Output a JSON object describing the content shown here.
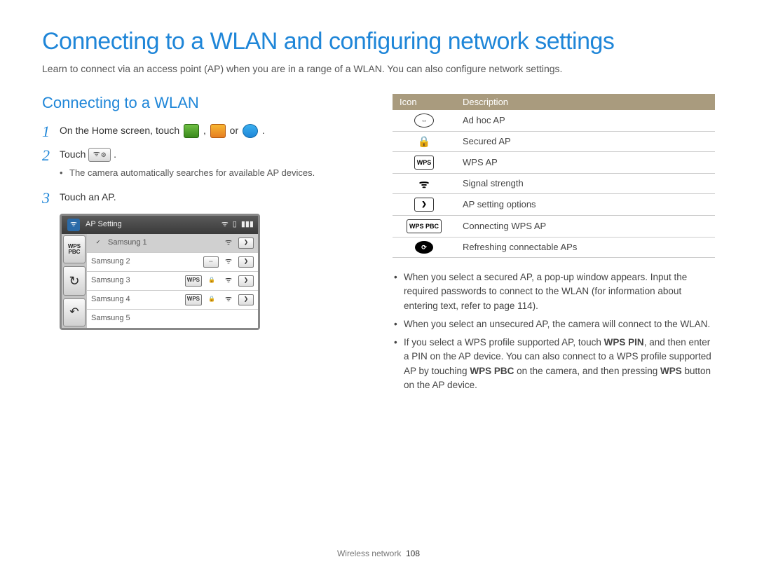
{
  "title": "Connecting to a WLAN and configuring network settings",
  "intro": "Learn to connect via an access point (AP) when you are in a range of a WLAN. You can also configure network settings.",
  "section": "Connecting to a WLAN",
  "steps": {
    "s1a": "On the Home screen, touch ",
    "s1b": ", ",
    "s1c": " or ",
    "s1d": ".",
    "s2a": "Touch ",
    "s2b": ".",
    "s2_sub": "The camera automatically searches for available AP devices.",
    "s3": "Touch an AP."
  },
  "device": {
    "header": "AP Setting",
    "side": {
      "wps": "WPS\nPBC",
      "refresh": "↻",
      "back": "↶"
    },
    "rows": [
      {
        "name": "Samsung 1",
        "selected": true,
        "badges": [
          "check",
          "wifi",
          "arrow"
        ]
      },
      {
        "name": "Samsung 2",
        "selected": false,
        "badges": [
          "adhoc",
          "wifi",
          "arrow"
        ]
      },
      {
        "name": "Samsung 3",
        "selected": false,
        "badges": [
          "wps",
          "lock",
          "wifi",
          "arrow"
        ]
      },
      {
        "name": "Samsung 4",
        "selected": false,
        "badges": [
          "wps",
          "lock",
          "wifi",
          "arrow"
        ]
      },
      {
        "name": "Samsung 5",
        "selected": false,
        "badges": []
      }
    ]
  },
  "table": {
    "h1": "Icon",
    "h2": "Description",
    "rows": [
      {
        "icon": "adhoc",
        "desc": "Ad hoc AP"
      },
      {
        "icon": "lock",
        "desc": "Secured AP"
      },
      {
        "icon": "wps",
        "desc": "WPS AP"
      },
      {
        "icon": "wifi",
        "desc": "Signal strength"
      },
      {
        "icon": "arrow",
        "desc": "AP setting options"
      },
      {
        "icon": "wpspbc",
        "desc": "Connecting WPS AP"
      },
      {
        "icon": "refresh",
        "desc": "Refreshing connectable APs"
      }
    ]
  },
  "notes": {
    "n1": "When you select a secured AP, a pop-up window appears. Input the required passwords to connect to the WLAN (for information about entering text, refer to page 114).",
    "n2": "When you select an unsecured AP, the camera will connect to the WLAN.",
    "n3a": "If you select a WPS profile supported AP, touch ",
    "n3b": "WPS PIN",
    "n3c": ", and then enter a PIN on the AP device. You can also connect to a WPS profile supported AP by touching ",
    "n3d": "WPS PBC",
    "n3e": " on the camera, and then pressing ",
    "n3f": "WPS",
    "n3g": " button on the AP device."
  },
  "footer": {
    "section": "Wireless network",
    "page": "108"
  },
  "glyph": {
    "check": "✓",
    "wifi": "ᯤ",
    "arrow": "❯",
    "adhoc": "⇔",
    "lock": "🔒",
    "wps": "WPS",
    "wpspbc": "WPS PBC",
    "refresh": "⟳",
    "battery": "▮▮▮",
    "sd": "▯",
    "gear": "⚙"
  }
}
